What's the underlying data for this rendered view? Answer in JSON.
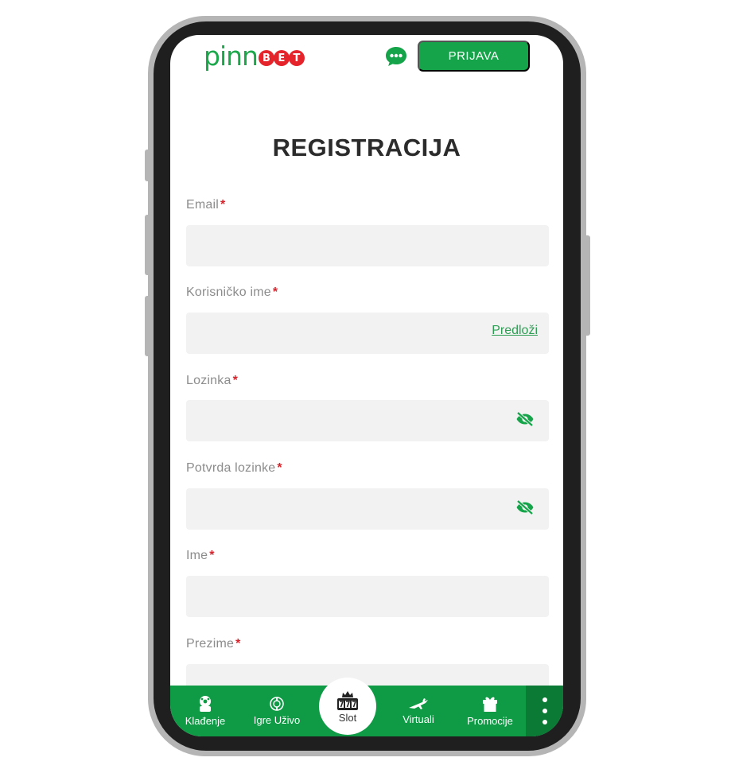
{
  "header": {
    "logo_main": "pinn",
    "logo_bet": [
      "B",
      "E",
      "T"
    ],
    "chat_icon": "chat-bubble-icon",
    "login_label": "PRIJAVA"
  },
  "page": {
    "title": "REGISTRACIJA"
  },
  "form": {
    "email": {
      "label": "Email",
      "required": "*",
      "value": ""
    },
    "username": {
      "label": "Korisničko ime",
      "required": "*",
      "value": "",
      "suggest": "Predloži"
    },
    "password": {
      "label": "Lozinka",
      "required": "*",
      "value": "",
      "icon": "eye-off-icon"
    },
    "password_confirm": {
      "label": "Potvrda lozinke",
      "required": "*",
      "value": "",
      "icon": "eye-off-icon"
    },
    "first_name": {
      "label": "Ime",
      "required": "*",
      "value": ""
    },
    "last_name": {
      "label": "Prezime",
      "required": "*",
      "value": ""
    }
  },
  "bottom_nav": {
    "items": [
      {
        "label": "Klađenje",
        "icon": "soccer-bet-icon"
      },
      {
        "label": "Igre Uživo",
        "icon": "live-games-icon"
      },
      {
        "label": "Slot",
        "icon": "slot-777-icon"
      },
      {
        "label": "Virtuali",
        "icon": "virtual-plane-icon"
      },
      {
        "label": "Promocije",
        "icon": "gift-icon"
      }
    ],
    "more_icon": "more-vertical-icon"
  },
  "colors": {
    "brand_green": "#15a44a",
    "brand_red": "#e4232b",
    "nav_green": "#0f9a45",
    "input_bg": "#f2f2f2"
  }
}
